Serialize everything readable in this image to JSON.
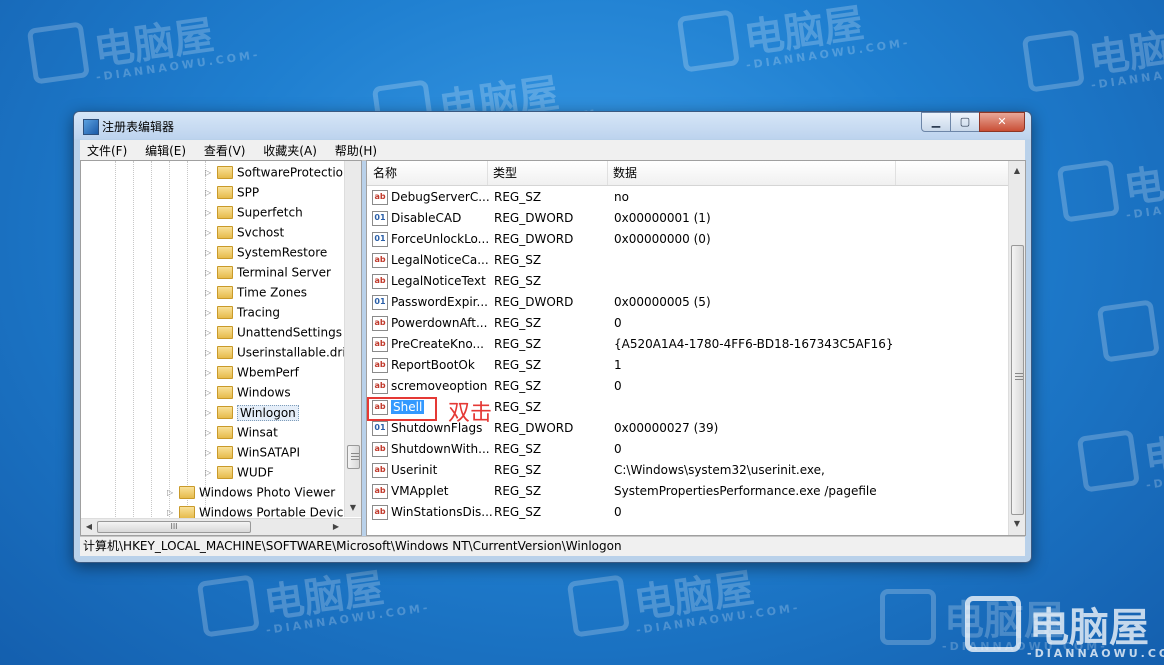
{
  "window": {
    "title": "注册表编辑器",
    "minimize_glyph": "▁",
    "maximize_glyph": "▢",
    "close_glyph": "✕"
  },
  "menu": [
    "文件(F)",
    "编辑(E)",
    "查看(V)",
    "收藏夹(A)",
    "帮助(H)"
  ],
  "tree": {
    "items": [
      {
        "label": "SoftwareProtectio"
      },
      {
        "label": "SPP"
      },
      {
        "label": "Superfetch"
      },
      {
        "label": "Svchost"
      },
      {
        "label": "SystemRestore"
      },
      {
        "label": "Terminal Server"
      },
      {
        "label": "Time Zones"
      },
      {
        "label": "Tracing"
      },
      {
        "label": "UnattendSettings"
      },
      {
        "label": "Userinstallable.dri"
      },
      {
        "label": "WbemPerf"
      },
      {
        "label": "Windows"
      },
      {
        "label": "Winlogon",
        "selected": true
      },
      {
        "label": "Winsat"
      },
      {
        "label": "WinSATAPI"
      },
      {
        "label": "WUDF"
      },
      {
        "label": "Windows Photo Viewer"
      },
      {
        "label": "Windows Portable Devic"
      }
    ],
    "hscroll_grip": "III"
  },
  "list": {
    "columns": [
      "名称",
      "类型",
      "数据"
    ],
    "rows": [
      {
        "icon": "string-value-icon",
        "name": "DebugServerC...",
        "type": "REG_SZ",
        "data": "no"
      },
      {
        "icon": "dword-value-icon",
        "name": "DisableCAD",
        "type": "REG_DWORD",
        "data": "0x00000001 (1)"
      },
      {
        "icon": "dword-value-icon",
        "name": "ForceUnlockLo...",
        "type": "REG_DWORD",
        "data": "0x00000000 (0)"
      },
      {
        "icon": "string-value-icon",
        "name": "LegalNoticeCa...",
        "type": "REG_SZ",
        "data": ""
      },
      {
        "icon": "string-value-icon",
        "name": "LegalNoticeText",
        "type": "REG_SZ",
        "data": ""
      },
      {
        "icon": "dword-value-icon",
        "name": "PasswordExpir...",
        "type": "REG_DWORD",
        "data": "0x00000005 (5)"
      },
      {
        "icon": "string-value-icon",
        "name": "PowerdownAft...",
        "type": "REG_SZ",
        "data": "0"
      },
      {
        "icon": "string-value-icon",
        "name": "PreCreateKno...",
        "type": "REG_SZ",
        "data": "{A520A1A4-1780-4FF6-BD18-167343C5AF16}"
      },
      {
        "icon": "string-value-icon",
        "name": "ReportBootOk",
        "type": "REG_SZ",
        "data": "1"
      },
      {
        "icon": "string-value-icon",
        "name": "scremoveoption",
        "type": "REG_SZ",
        "data": "0"
      },
      {
        "icon": "string-value-icon",
        "name": "Shell",
        "type": "REG_SZ",
        "data": "",
        "selected": true
      },
      {
        "icon": "dword-value-icon",
        "name": "ShutdownFlags",
        "type": "REG_DWORD",
        "data": "0x00000027 (39)"
      },
      {
        "icon": "string-value-icon",
        "name": "ShutdownWith...",
        "type": "REG_SZ",
        "data": "0"
      },
      {
        "icon": "string-value-icon",
        "name": "Userinit",
        "type": "REG_SZ",
        "data": "C:\\Windows\\system32\\userinit.exe,"
      },
      {
        "icon": "string-value-icon",
        "name": "VMApplet",
        "type": "REG_SZ",
        "data": "SystemPropertiesPerformance.exe /pagefile"
      },
      {
        "icon": "string-value-icon",
        "name": "WinStationsDis...",
        "type": "REG_SZ",
        "data": "0"
      }
    ]
  },
  "annotation": "双击",
  "status": "计算机\\HKEY_LOCAL_MACHINE\\SOFTWARE\\Microsoft\\Windows NT\\CurrentVersion\\Winlogon",
  "watermark": {
    "brand": "电脑屋",
    "domain": "-DIANNAOWU.COM-"
  },
  "colors": {
    "selection": "#3399ff",
    "annotation": "#e53935"
  }
}
